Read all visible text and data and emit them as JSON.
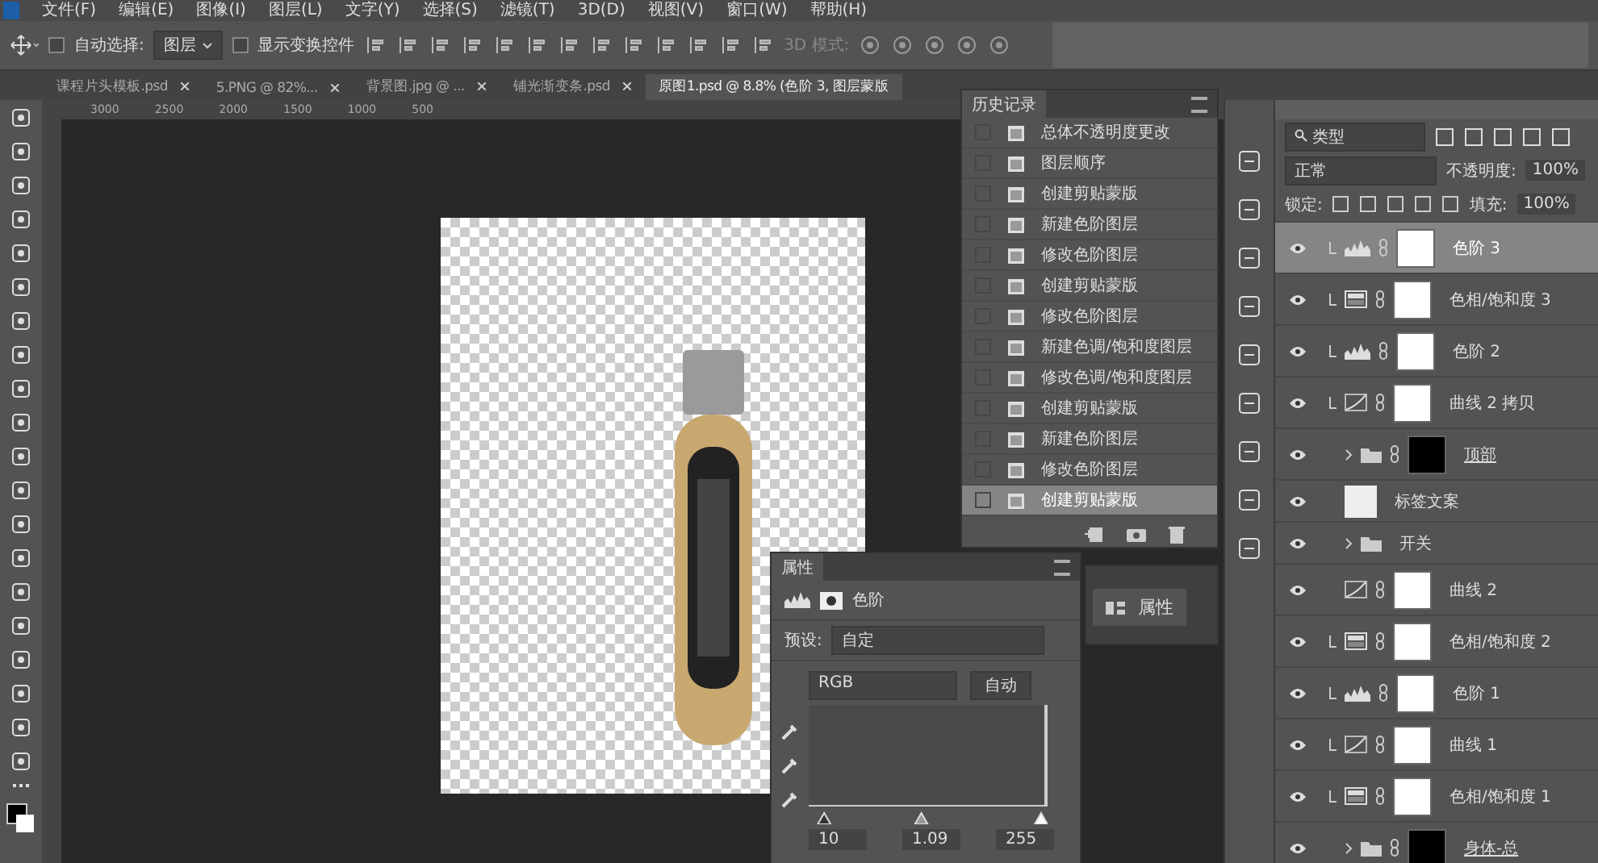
{
  "menu": [
    "文件(F)",
    "编辑(E)",
    "图像(I)",
    "图层(L)",
    "文字(Y)",
    "选择(S)",
    "滤镜(T)",
    "3D(D)",
    "视图(V)",
    "窗口(W)",
    "帮助(H)"
  ],
  "options": {
    "auto_select_label": "自动选择:",
    "auto_select_checked": false,
    "auto_select_value": "图层",
    "show_transform_label": "显示变换控件",
    "show_transform_checked": false,
    "mode_3d": "3D 模式:"
  },
  "tabs": [
    {
      "label": "课程片头模板.psd",
      "selected": false
    },
    {
      "label": "5.PNG @ 82%...",
      "selected": false
    },
    {
      "label": "背景图.jpg @ ...",
      "selected": false
    },
    {
      "label": "铺光渐变条.psd",
      "selected": false
    },
    {
      "label": "原图1.psd @ 8.8% (色阶 3, 图层蒙版",
      "selected": true
    }
  ],
  "ruler": [
    "3000",
    "2500",
    "2000",
    "1500",
    "1000",
    "500"
  ],
  "history": {
    "title": "历史记录",
    "items": [
      {
        "label": "总体不透明度更改",
        "selected": false
      },
      {
        "label": "图层顺序",
        "selected": false
      },
      {
        "label": "创建剪贴蒙版",
        "selected": false
      },
      {
        "label": "新建色阶图层",
        "selected": false
      },
      {
        "label": "修改色阶图层",
        "selected": false
      },
      {
        "label": "创建剪贴蒙版",
        "selected": false
      },
      {
        "label": "修改色阶图层",
        "selected": false
      },
      {
        "label": "新建色调/饱和度图层",
        "selected": false
      },
      {
        "label": "修改色调/饱和度图层",
        "selected": false
      },
      {
        "label": "创建剪贴蒙版",
        "selected": false
      },
      {
        "label": "新建色阶图层",
        "selected": false
      },
      {
        "label": "修改色阶图层",
        "selected": false
      },
      {
        "label": "创建剪贴蒙版",
        "selected": true
      }
    ]
  },
  "properties": {
    "title": "属性",
    "type_label": "色阶",
    "preset_label": "预设:",
    "preset_value": "自定",
    "channel": "RGB",
    "auto_button": "自动",
    "handles": [
      {
        "kind": "black",
        "level": 0.04
      },
      {
        "kind": "gray",
        "level": 0.47
      },
      {
        "kind": "white",
        "level": 1
      }
    ],
    "inputs": [
      "10",
      "1.09",
      "255"
    ]
  },
  "mini_panel": {
    "label": "属性"
  },
  "layers": {
    "filter": "类型",
    "blend": "正常",
    "opacity_label": "不透明度:",
    "opacity": "100%",
    "lock_label": "锁定:",
    "fill_label": "填充:",
    "fill": "100%",
    "items": [
      {
        "name": "色阶 3",
        "kind": "levels",
        "clipped": true,
        "selected": true,
        "has_mask": true,
        "mask_dark": false
      },
      {
        "name": "色相/饱和度 3",
        "kind": "huesat",
        "clipped": true,
        "selected": false,
        "has_mask": true,
        "mask_dark": false
      },
      {
        "name": "色阶 2",
        "kind": "levels",
        "clipped": true,
        "selected": false,
        "has_mask": true,
        "mask_dark": false
      },
      {
        "name": "曲线 2 拷贝",
        "kind": "curves",
        "clipped": true,
        "selected": false,
        "has_mask": true,
        "mask_dark": false
      },
      {
        "name": "顶部",
        "kind": "group",
        "clipped": false,
        "selected": false,
        "has_mask": true,
        "mask_dark": true
      },
      {
        "name": "标签文案",
        "kind": "pixel",
        "clipped": false,
        "selected": false,
        "has_mask": false
      },
      {
        "name": "开关",
        "kind": "group",
        "clipped": false,
        "selected": false,
        "has_mask": false
      },
      {
        "name": "曲线 2",
        "kind": "curves",
        "clipped": false,
        "selected": false,
        "has_mask": true,
        "mask_dark": false
      },
      {
        "name": "色相/饱和度 2",
        "kind": "huesat",
        "clipped": true,
        "selected": false,
        "has_mask": true,
        "mask_dark": false
      },
      {
        "name": "色阶 1",
        "kind": "levels",
        "clipped": true,
        "selected": false,
        "has_mask": true,
        "mask_dark": false
      },
      {
        "name": "曲线 1",
        "kind": "curves",
        "clipped": true,
        "selected": false,
        "has_mask": true,
        "mask_dark": false
      },
      {
        "name": "色相/饱和度 1",
        "kind": "huesat",
        "clipped": true,
        "selected": false,
        "has_mask": true,
        "mask_dark": false
      },
      {
        "name": "身体-总",
        "kind": "group",
        "clipped": false,
        "selected": false,
        "has_mask": true,
        "mask_dark": true
      }
    ]
  }
}
